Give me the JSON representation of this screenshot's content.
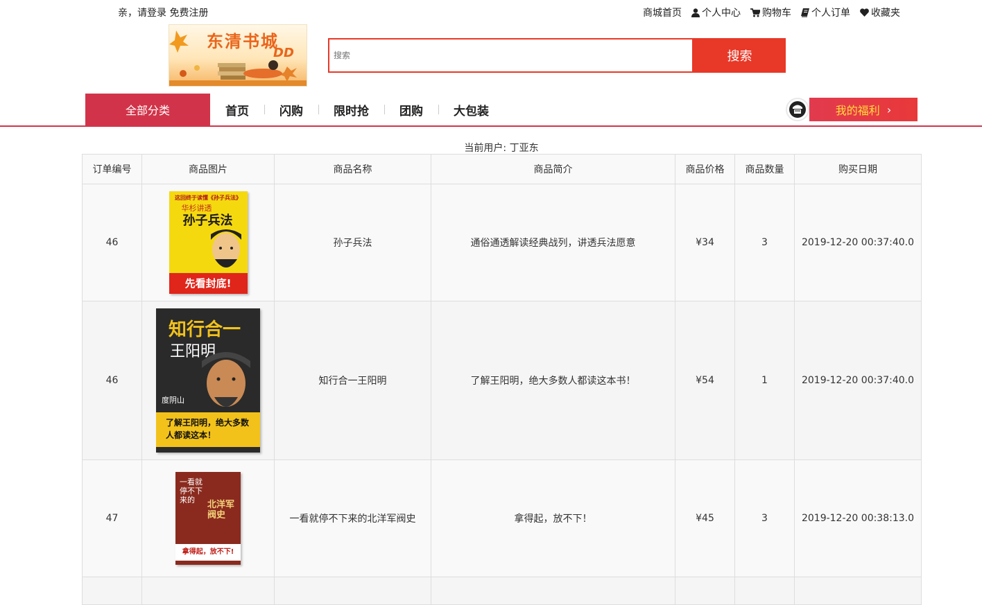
{
  "topbar": {
    "login_text": "亲，请登录",
    "register_text": "免费注册",
    "links": [
      {
        "label": "商城首页",
        "icon": ""
      },
      {
        "label": "个人中心",
        "icon": "user-icon"
      },
      {
        "label": "购物车",
        "icon": "cart-icon"
      },
      {
        "label": "个人订单",
        "icon": "book-icon"
      },
      {
        "label": "收藏夹",
        "icon": "heart-icon"
      }
    ]
  },
  "logo": {
    "title": "东清书城",
    "sub": "DD"
  },
  "search": {
    "placeholder": "搜索",
    "button_label": "搜索"
  },
  "nav": {
    "all_categories": "全部分类",
    "items": [
      "首页",
      "闪购",
      "限时抢",
      "团购",
      "大包装"
    ],
    "welfare_label": "我的福利",
    "welfare_arrow": "›"
  },
  "current_user": "当前用户: 丁亚东",
  "orders": {
    "headers": [
      "订单编号",
      "商品图片",
      "商品名称",
      "商品简介",
      "商品价格",
      "商品数量",
      "购买日期"
    ],
    "rows": [
      {
        "id": "46",
        "name": "孙子兵法",
        "desc": "通俗通透解读经典战列，讲透兵法愿意",
        "price": "¥34",
        "qty": "3",
        "date": "2019-12-20 00:37:40.0",
        "cover": {
          "top": "这回终于读懂《孙子兵法》",
          "title": "孙子兵法",
          "sub": "华杉讲透",
          "bottom": "先看封底!",
          "bg": "#f5d90f",
          "accent": "#e0251b"
        }
      },
      {
        "id": "46",
        "name": "知行合一王阳明",
        "desc": "了解王阳明，绝大多数人都读这本书！",
        "price": "¥54",
        "qty": "1",
        "date": "2019-12-20 00:37:40.0",
        "cover": {
          "top": "知行合一",
          "title": "王阳明",
          "sub": "度阴山",
          "bottom": "了解王阳明，绝大多数人都读这本！",
          "bg": "#2a2a2a",
          "accent": "#f2c21b"
        }
      },
      {
        "id": "47",
        "name": "一看就停不下来的北洋军阀史",
        "desc": "拿得起，放不下！",
        "price": "¥45",
        "qty": "3",
        "date": "2019-12-20 00:38:13.0",
        "cover": {
          "top": "一看就停不下来的",
          "title": "北洋军阀史",
          "sub": "",
          "bottom": "拿得起，放不下!",
          "bg": "#8a2a1e",
          "accent": "#ffffff"
        }
      }
    ]
  }
}
